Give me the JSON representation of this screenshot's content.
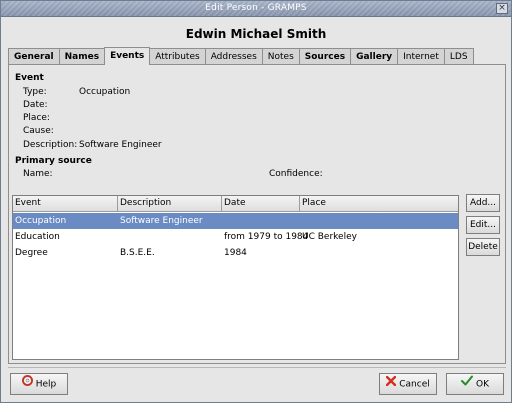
{
  "window": {
    "title": "Edit Person - GRAMPS",
    "close_glyph": "×"
  },
  "person": {
    "name": "Edwin Michael Smith"
  },
  "tabs": [
    {
      "label": "General",
      "bold": true,
      "active": false
    },
    {
      "label": "Names",
      "bold": true,
      "active": false
    },
    {
      "label": "Events",
      "bold": true,
      "active": true
    },
    {
      "label": "Attributes",
      "bold": false,
      "active": false
    },
    {
      "label": "Addresses",
      "bold": false,
      "active": false
    },
    {
      "label": "Notes",
      "bold": false,
      "active": false
    },
    {
      "label": "Sources",
      "bold": true,
      "active": false
    },
    {
      "label": "Gallery",
      "bold": true,
      "active": false
    },
    {
      "label": "Internet",
      "bold": false,
      "active": false
    },
    {
      "label": "LDS",
      "bold": false,
      "active": false
    }
  ],
  "event": {
    "section_title": "Event",
    "type_label": "Type:",
    "type_value": "Occupation",
    "date_label": "Date:",
    "date_value": "",
    "place_label": "Place:",
    "place_value": "",
    "cause_label": "Cause:",
    "cause_value": "",
    "description_label": "Description:",
    "description_value": "Software Engineer"
  },
  "primary_source": {
    "section_title": "Primary source",
    "name_label": "Name:",
    "confidence_label": "Confidence:"
  },
  "events_table": {
    "columns": [
      "Event",
      "Description",
      "Date",
      "Place"
    ],
    "rows": [
      {
        "event": "Occupation",
        "description": "Software Engineer",
        "date": "",
        "place": "",
        "selected": true
      },
      {
        "event": "Education",
        "description": "",
        "date": "from 1979 to 1984",
        "place": "UC Berkeley",
        "selected": false
      },
      {
        "event": "Degree",
        "description": "B.S.E.E.",
        "date": "1984",
        "place": "",
        "selected": false
      }
    ]
  },
  "side_buttons": {
    "add": "Add...",
    "edit": "Edit...",
    "delete": "Delete"
  },
  "footer": {
    "help_label": "Help",
    "cancel_label": "Cancel",
    "ok_label": "OK",
    "colors": {
      "selection": "#6b8bc4",
      "title_gradient_top": "#a7b4c8",
      "cancel_icon": "#d62d20",
      "ok_icon": "#2b8a2b"
    }
  }
}
